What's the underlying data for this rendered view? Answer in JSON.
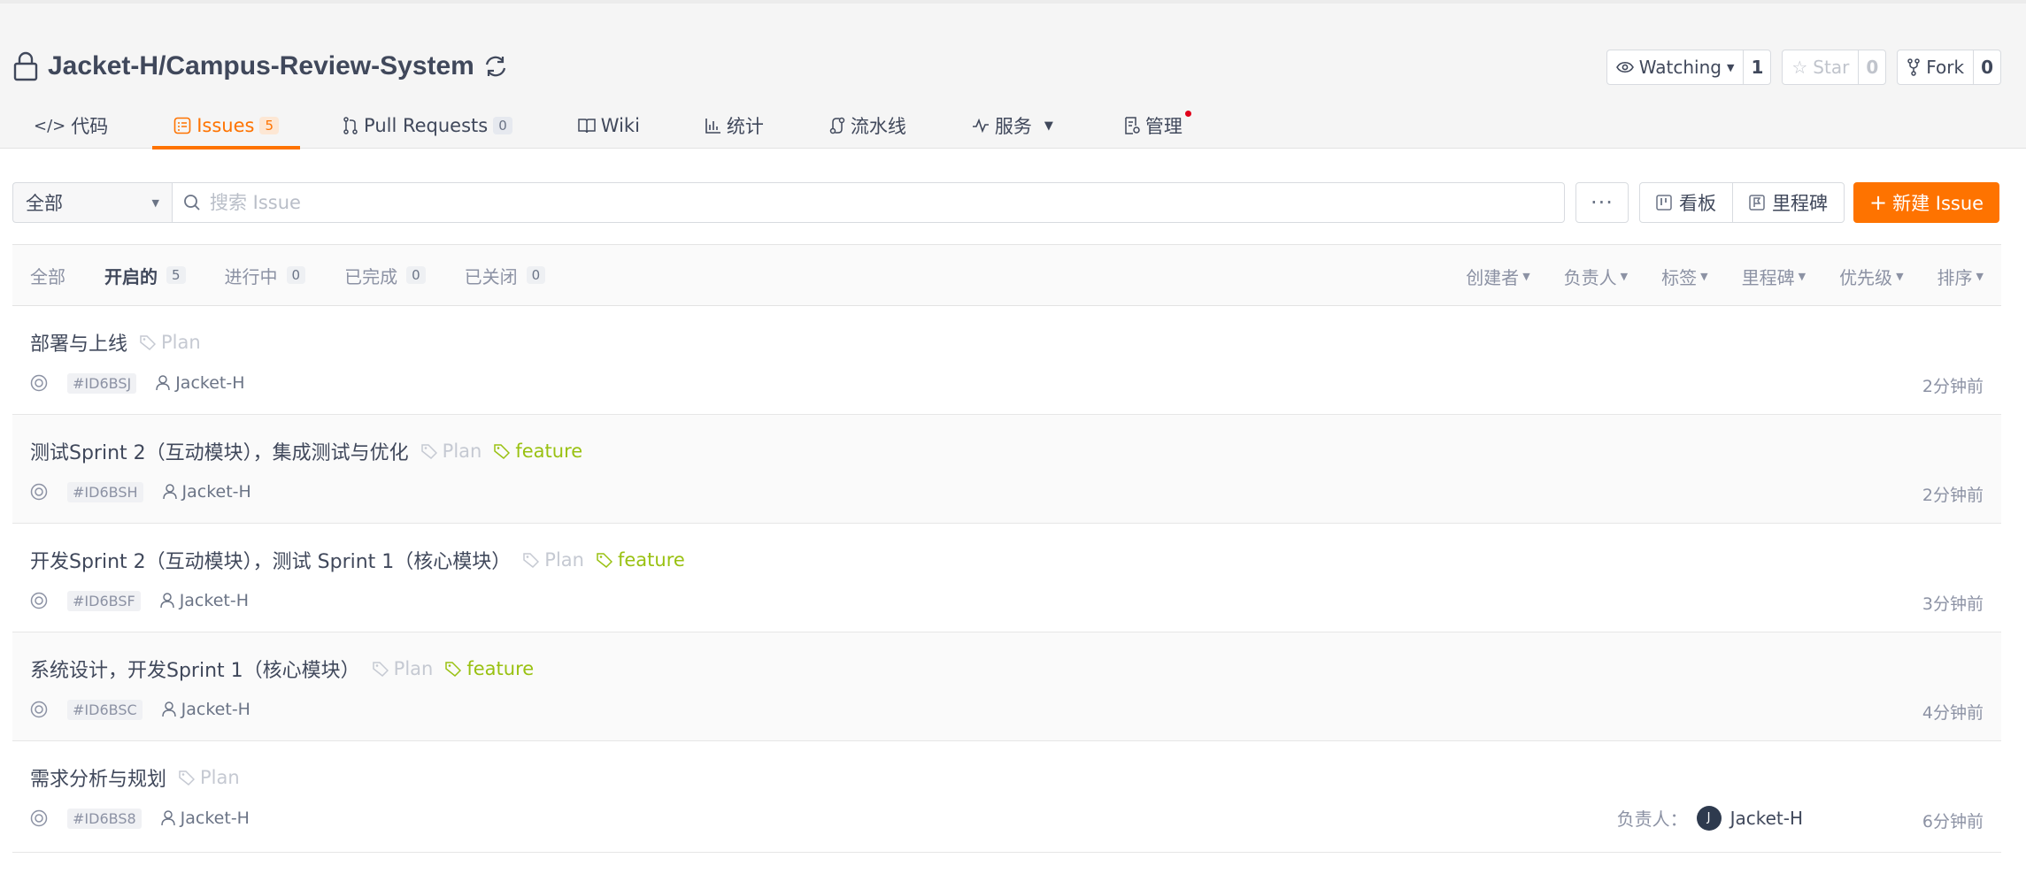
{
  "repo": {
    "owner": "Jacket-H",
    "name": "Jacket-H/Campus-Review-System",
    "watching_label": "Watching",
    "watching_count": "1",
    "star_label": "Star",
    "star_count": "0",
    "fork_label": "Fork",
    "fork_count": "0"
  },
  "tabs": [
    {
      "label": "代码",
      "icon": "code-icon"
    },
    {
      "label": "Issues",
      "badge": "5",
      "icon": "issues-icon",
      "active": true
    },
    {
      "label": "Pull Requests",
      "badge": "0",
      "icon": "pull-request-icon"
    },
    {
      "label": "Wiki",
      "icon": "book-icon"
    },
    {
      "label": "统计",
      "icon": "chart-icon"
    },
    {
      "label": "流水线",
      "icon": "pipeline-icon"
    },
    {
      "label": "服务",
      "icon": "pulse-icon"
    },
    {
      "label": "管理",
      "icon": "settings-doc-icon"
    }
  ],
  "toolbar": {
    "scope_value": "全部",
    "search_placeholder": "搜索 Issue",
    "more_label": "···",
    "board_label": "看板",
    "milestone_label": "里程碑",
    "new_issue_label": "新建 Issue"
  },
  "states": [
    {
      "label": "全部"
    },
    {
      "label": "开启的",
      "count": "5",
      "active": true
    },
    {
      "label": "进行中",
      "count": "0"
    },
    {
      "label": "已完成",
      "count": "0"
    },
    {
      "label": "已关闭",
      "count": "0"
    }
  ],
  "filters": [
    "创建者",
    "负责人",
    "标签",
    "里程碑",
    "优先级",
    "排序"
  ],
  "issues": [
    {
      "title": "部署与上线",
      "labels": [
        "Plan"
      ],
      "id": "#ID6BSJ",
      "author": "Jacket-H",
      "time": "2分钟前"
    },
    {
      "title": "测试Sprint 2（互动模块），集成测试与优化",
      "labels": [
        "Plan",
        "feature"
      ],
      "id": "#ID6BSH",
      "author": "Jacket-H",
      "time": "2分钟前"
    },
    {
      "title": "开发Sprint 2（互动模块），测试 Sprint 1（核心模块）",
      "labels": [
        "Plan",
        "feature"
      ],
      "id": "#ID6BSF",
      "author": "Jacket-H",
      "time": "3分钟前"
    },
    {
      "title": "系统设计，开发Sprint 1（核心模块）",
      "labels": [
        "Plan",
        "feature"
      ],
      "id": "#ID6BSC",
      "author": "Jacket-H",
      "time": "4分钟前"
    },
    {
      "title": "需求分析与规划",
      "labels": [
        "Plan"
      ],
      "id": "#ID6BS8",
      "author": "Jacket-H",
      "time": "6分钟前",
      "assignee_label": "负责人：",
      "assignee_initial": "J",
      "assignee_name": "Jacket-H"
    }
  ],
  "colors": {
    "accent": "#fe7300",
    "feature": "#99c111",
    "plan": "#c5c9d2"
  }
}
